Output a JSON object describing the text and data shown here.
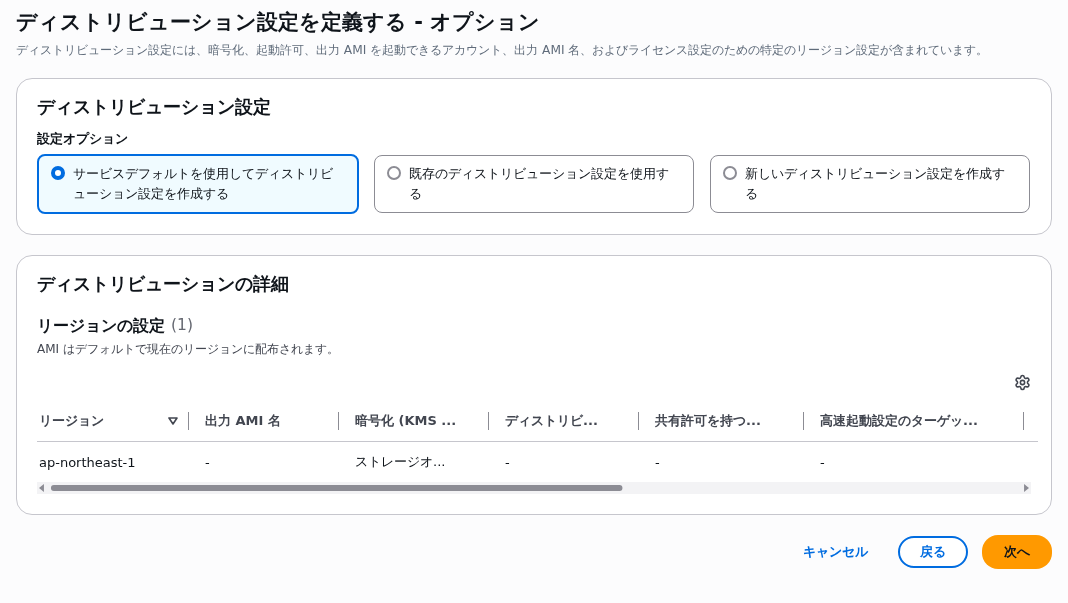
{
  "page": {
    "title": "ディストリビューション設定を定義する - オプション",
    "description": "ディストリビューション設定には、暗号化、起動許可、出力 AMI を起動できるアカウント、出力 AMI 名、およびライセンス設定のための特定のリージョン設定が含まれています。"
  },
  "settings": {
    "title": "ディストリビューション設定",
    "group_label": "設定オプション",
    "options": [
      {
        "label": "サービスデフォルトを使用してディストリビューション設定を作成する",
        "selected": true
      },
      {
        "label": "既存のディストリビューション設定を使用する",
        "selected": false
      },
      {
        "label": "新しいディストリビューション設定を作成する",
        "selected": false
      }
    ]
  },
  "details": {
    "title": "ディストリビューションの詳細",
    "region_heading": "リージョンの設定",
    "region_count": "(1)",
    "region_description": "AMI はデフォルトで現在のリージョンに配布されます。",
    "table": {
      "columns": [
        {
          "label": "リージョン",
          "sortable": true
        },
        {
          "label": "出力 AMI 名",
          "sortable": false
        },
        {
          "label": "暗号化 (KMS ...",
          "sortable": false
        },
        {
          "label": "ディストリビ...",
          "sortable": false
        },
        {
          "label": "共有許可を持つ...",
          "sortable": false
        },
        {
          "label": "高速起動設定のターゲッ...",
          "sortable": false
        }
      ],
      "rows": [
        [
          "ap-northeast-1",
          "-",
          "ストレージオ...",
          "-",
          "-",
          "-"
        ]
      ]
    }
  },
  "footer": {
    "cancel": "キャンセル",
    "back": "戻る",
    "next": "次へ"
  }
}
